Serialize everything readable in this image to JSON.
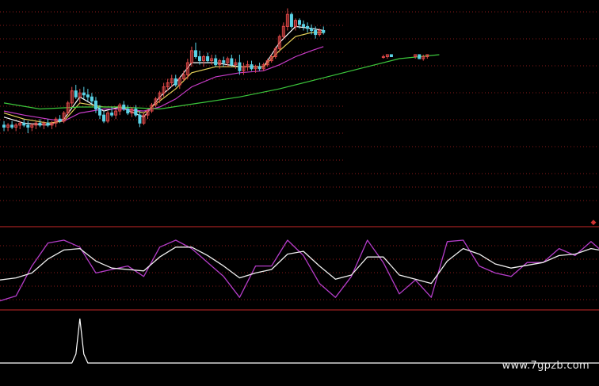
{
  "watermark": "www.7gpzb.com",
  "colors": {
    "background": "#000000",
    "grid": "#8a1a1a",
    "separator": "#c82828",
    "candle_up": "#e04848",
    "candle_down": "#5ad2e6",
    "ma_short": "#ffffff",
    "ma_mid": "#e6d25a",
    "ma_long": "#c83cc8",
    "ma_longest": "#3cc83c",
    "osc_fast": "#b43cc8",
    "osc_slow": "#f0f0f0",
    "signal": "#ffffff",
    "marker": "#d23232"
  },
  "chart_data": [
    {
      "type": "candlestick",
      "panel": "price",
      "x_range": [
        0,
        150
      ],
      "ylim": [
        0,
        100
      ],
      "grid": true,
      "candles": [
        {
          "x": 1,
          "o": 41,
          "h": 43,
          "l": 38,
          "c": 40
        },
        {
          "x": 2,
          "o": 40,
          "h": 42,
          "l": 38,
          "c": 41
        },
        {
          "x": 3,
          "o": 41,
          "h": 43,
          "l": 39,
          "c": 40
        },
        {
          "x": 4,
          "o": 40,
          "h": 42,
          "l": 38,
          "c": 41
        },
        {
          "x": 5,
          "o": 41,
          "h": 43,
          "l": 39,
          "c": 42
        },
        {
          "x": 6,
          "o": 42,
          "h": 44,
          "l": 40,
          "c": 41
        },
        {
          "x": 7,
          "o": 41,
          "h": 43,
          "l": 37,
          "c": 40
        },
        {
          "x": 8,
          "o": 40,
          "h": 42,
          "l": 38,
          "c": 41
        },
        {
          "x": 9,
          "o": 41,
          "h": 43,
          "l": 39,
          "c": 42
        },
        {
          "x": 10,
          "o": 42,
          "h": 44,
          "l": 40,
          "c": 41
        },
        {
          "x": 11,
          "o": 41,
          "h": 43,
          "l": 39,
          "c": 42
        },
        {
          "x": 12,
          "o": 42,
          "h": 44,
          "l": 40,
          "c": 41
        },
        {
          "x": 13,
          "o": 41,
          "h": 43,
          "l": 39,
          "c": 42
        },
        {
          "x": 14,
          "o": 42,
          "h": 45,
          "l": 40,
          "c": 44
        },
        {
          "x": 15,
          "o": 44,
          "h": 46,
          "l": 42,
          "c": 43
        },
        {
          "x": 16,
          "o": 43,
          "h": 48,
          "l": 42,
          "c": 47
        },
        {
          "x": 17,
          "o": 47,
          "h": 53,
          "l": 46,
          "c": 52
        },
        {
          "x": 18,
          "o": 52,
          "h": 60,
          "l": 50,
          "c": 58
        },
        {
          "x": 19,
          "o": 58,
          "h": 61,
          "l": 54,
          "c": 55
        },
        {
          "x": 20,
          "o": 55,
          "h": 59,
          "l": 52,
          "c": 57
        },
        {
          "x": 21,
          "o": 57,
          "h": 60,
          "l": 54,
          "c": 56
        },
        {
          "x": 22,
          "o": 56,
          "h": 59,
          "l": 53,
          "c": 55
        },
        {
          "x": 23,
          "o": 55,
          "h": 57,
          "l": 51,
          "c": 53
        },
        {
          "x": 24,
          "o": 53,
          "h": 55,
          "l": 47,
          "c": 49
        },
        {
          "x": 25,
          "o": 49,
          "h": 51,
          "l": 44,
          "c": 46
        },
        {
          "x": 26,
          "o": 46,
          "h": 48,
          "l": 42,
          "c": 43
        },
        {
          "x": 27,
          "o": 43,
          "h": 48,
          "l": 42,
          "c": 47
        },
        {
          "x": 28,
          "o": 47,
          "h": 50,
          "l": 45,
          "c": 46
        },
        {
          "x": 29,
          "o": 46,
          "h": 49,
          "l": 44,
          "c": 48
        },
        {
          "x": 30,
          "o": 48,
          "h": 52,
          "l": 46,
          "c": 51
        },
        {
          "x": 31,
          "o": 51,
          "h": 53,
          "l": 48,
          "c": 49
        },
        {
          "x": 32,
          "o": 49,
          "h": 51,
          "l": 46,
          "c": 47
        },
        {
          "x": 33,
          "o": 47,
          "h": 50,
          "l": 45,
          "c": 49
        },
        {
          "x": 34,
          "o": 49,
          "h": 51,
          "l": 45,
          "c": 46
        },
        {
          "x": 35,
          "o": 46,
          "h": 48,
          "l": 40,
          "c": 42
        },
        {
          "x": 36,
          "o": 42,
          "h": 47,
          "l": 41,
          "c": 46
        },
        {
          "x": 37,
          "o": 46,
          "h": 49,
          "l": 44,
          "c": 48
        },
        {
          "x": 38,
          "o": 48,
          "h": 52,
          "l": 47,
          "c": 51
        },
        {
          "x": 39,
          "o": 51,
          "h": 55,
          "l": 50,
          "c": 54
        },
        {
          "x": 40,
          "o": 54,
          "h": 58,
          "l": 52,
          "c": 57
        },
        {
          "x": 41,
          "o": 57,
          "h": 62,
          "l": 55,
          "c": 60
        },
        {
          "x": 42,
          "o": 60,
          "h": 64,
          "l": 58,
          "c": 62
        },
        {
          "x": 43,
          "o": 62,
          "h": 66,
          "l": 60,
          "c": 64
        },
        {
          "x": 44,
          "o": 64,
          "h": 66,
          "l": 60,
          "c": 61
        },
        {
          "x": 45,
          "o": 61,
          "h": 65,
          "l": 59,
          "c": 64
        },
        {
          "x": 46,
          "o": 64,
          "h": 68,
          "l": 63,
          "c": 66
        },
        {
          "x": 47,
          "o": 66,
          "h": 74,
          "l": 64,
          "c": 72
        },
        {
          "x": 48,
          "o": 72,
          "h": 80,
          "l": 70,
          "c": 78
        },
        {
          "x": 49,
          "o": 78,
          "h": 82,
          "l": 74,
          "c": 75
        },
        {
          "x": 50,
          "o": 75,
          "h": 78,
          "l": 71,
          "c": 73
        },
        {
          "x": 51,
          "o": 73,
          "h": 76,
          "l": 70,
          "c": 75
        },
        {
          "x": 52,
          "o": 75,
          "h": 77,
          "l": 72,
          "c": 73
        },
        {
          "x": 53,
          "o": 73,
          "h": 76,
          "l": 71,
          "c": 74
        },
        {
          "x": 54,
          "o": 74,
          "h": 76,
          "l": 70,
          "c": 71
        },
        {
          "x": 55,
          "o": 71,
          "h": 74,
          "l": 69,
          "c": 73
        },
        {
          "x": 56,
          "o": 73,
          "h": 75,
          "l": 70,
          "c": 72
        },
        {
          "x": 57,
          "o": 72,
          "h": 75,
          "l": 70,
          "c": 74
        },
        {
          "x": 58,
          "o": 74,
          "h": 76,
          "l": 70,
          "c": 71
        },
        {
          "x": 59,
          "o": 71,
          "h": 74,
          "l": 69,
          "c": 72
        },
        {
          "x": 60,
          "o": 72,
          "h": 76,
          "l": 66,
          "c": 68
        },
        {
          "x": 61,
          "o": 68,
          "h": 72,
          "l": 66,
          "c": 70
        },
        {
          "x": 62,
          "o": 70,
          "h": 73,
          "l": 68,
          "c": 71
        },
        {
          "x": 63,
          "o": 71,
          "h": 73,
          "l": 68,
          "c": 69
        },
        {
          "x": 64,
          "o": 69,
          "h": 71,
          "l": 67,
          "c": 70
        },
        {
          "x": 65,
          "o": 70,
          "h": 72,
          "l": 68,
          "c": 69
        },
        {
          "x": 66,
          "o": 69,
          "h": 72,
          "l": 68,
          "c": 71
        },
        {
          "x": 67,
          "o": 71,
          "h": 74,
          "l": 70,
          "c": 73
        },
        {
          "x": 68,
          "o": 73,
          "h": 76,
          "l": 72,
          "c": 75
        },
        {
          "x": 69,
          "o": 75,
          "h": 80,
          "l": 74,
          "c": 79
        },
        {
          "x": 70,
          "o": 79,
          "h": 86,
          "l": 78,
          "c": 85
        },
        {
          "x": 71,
          "o": 85,
          "h": 92,
          "l": 84,
          "c": 90
        },
        {
          "x": 72,
          "o": 90,
          "h": 99,
          "l": 88,
          "c": 96
        },
        {
          "x": 73,
          "o": 96,
          "h": 97,
          "l": 89,
          "c": 90
        },
        {
          "x": 74,
          "o": 90,
          "h": 94,
          "l": 88,
          "c": 93
        },
        {
          "x": 75,
          "o": 93,
          "h": 94,
          "l": 89,
          "c": 91
        },
        {
          "x": 76,
          "o": 91,
          "h": 93,
          "l": 88,
          "c": 90
        },
        {
          "x": 77,
          "o": 90,
          "h": 92,
          "l": 87,
          "c": 89
        },
        {
          "x": 78,
          "o": 89,
          "h": 91,
          "l": 86,
          "c": 88
        },
        {
          "x": 79,
          "o": 88,
          "h": 90,
          "l": 84,
          "c": 86
        },
        {
          "x": 80,
          "o": 86,
          "h": 89,
          "l": 85,
          "c": 88
        },
        {
          "x": 81,
          "o": 88,
          "h": 90,
          "l": 86,
          "c": 87
        },
        {
          "x": 96,
          "o": 75,
          "h": 76,
          "l": 74,
          "c": 75
        },
        {
          "x": 97,
          "o": 75,
          "h": 76,
          "l": 74,
          "c": 76
        },
        {
          "x": 98,
          "o": 76,
          "h": 76,
          "l": 75,
          "c": 75
        },
        {
          "x": 104,
          "o": 75,
          "h": 76,
          "l": 74,
          "c": 76
        },
        {
          "x": 105,
          "o": 76,
          "h": 76,
          "l": 74,
          "c": 74
        },
        {
          "x": 106,
          "o": 74,
          "h": 76,
          "l": 73,
          "c": 75
        },
        {
          "x": 107,
          "o": 75,
          "h": 76,
          "l": 74,
          "c": 76
        }
      ],
      "series": [
        {
          "role": "ma_short",
          "x": [
            1,
            6,
            12,
            16,
            20,
            26,
            30,
            36,
            40,
            44,
            48,
            54,
            60,
            66,
            70,
            74,
            78,
            81
          ],
          "y": [
            45,
            42,
            41,
            44,
            55,
            48,
            50,
            45,
            55,
            62,
            72,
            72,
            70,
            70,
            82,
            90,
            89,
            88
          ]
        },
        {
          "role": "ma_mid",
          "x": [
            1,
            6,
            12,
            16,
            20,
            26,
            30,
            36,
            40,
            44,
            48,
            54,
            60,
            66,
            70,
            74,
            78,
            81
          ],
          "y": [
            47,
            44,
            42,
            43,
            52,
            50,
            50,
            47,
            53,
            59,
            67,
            70,
            70,
            70,
            78,
            85,
            87,
            87
          ]
        },
        {
          "role": "ma_long",
          "x": [
            1,
            6,
            12,
            16,
            20,
            26,
            30,
            36,
            40,
            44,
            48,
            54,
            60,
            66,
            70,
            74,
            78,
            81
          ],
          "y": [
            48,
            46,
            44,
            43,
            47,
            49,
            49,
            48,
            50,
            54,
            60,
            65,
            67,
            68,
            71,
            75,
            78,
            80
          ]
        },
        {
          "role": "ma_longest",
          "x": [
            1,
            10,
            20,
            30,
            40,
            50,
            60,
            70,
            80,
            90,
            100,
            110
          ],
          "y": [
            52,
            49,
            50,
            50,
            49,
            52,
            55,
            59,
            64,
            69,
            74,
            76
          ]
        }
      ]
    },
    {
      "type": "line",
      "panel": "oscillator",
      "x_range": [
        0,
        150
      ],
      "ylim": [
        0,
        100
      ],
      "grid": true,
      "series": [
        {
          "role": "osc_fast",
          "x": [
            0,
            4,
            8,
            12,
            16,
            20,
            24,
            28,
            32,
            36,
            40,
            44,
            48,
            52,
            56,
            60,
            64,
            68,
            72,
            76,
            80,
            84,
            88,
            92,
            96,
            100,
            104,
            108,
            112,
            116,
            120,
            124,
            128,
            132,
            136,
            140,
            144,
            148,
            150
          ],
          "y": [
            5,
            12,
            55,
            88,
            92,
            82,
            45,
            50,
            55,
            40,
            82,
            92,
            80,
            60,
            40,
            10,
            55,
            55,
            92,
            70,
            30,
            10,
            40,
            92,
            60,
            15,
            35,
            10,
            90,
            92,
            55,
            45,
            40,
            60,
            60,
            80,
            70,
            90,
            80
          ]
        },
        {
          "role": "osc_slow",
          "x": [
            0,
            4,
            8,
            12,
            16,
            20,
            24,
            28,
            32,
            36,
            40,
            44,
            48,
            52,
            56,
            60,
            64,
            68,
            72,
            76,
            80,
            84,
            88,
            92,
            96,
            100,
            104,
            108,
            112,
            116,
            120,
            124,
            128,
            132,
            136,
            140,
            144,
            148,
            150
          ],
          "y": [
            35,
            38,
            45,
            65,
            78,
            80,
            62,
            52,
            50,
            48,
            68,
            82,
            82,
            70,
            55,
            38,
            45,
            50,
            72,
            76,
            55,
            36,
            42,
            68,
            68,
            42,
            36,
            30,
            62,
            80,
            72,
            58,
            52,
            56,
            60,
            70,
            72,
            80,
            78
          ]
        }
      ]
    },
    {
      "type": "line",
      "panel": "signal",
      "x_range": [
        0,
        150
      ],
      "ylim": [
        0,
        100
      ],
      "series": [
        {
          "role": "signal",
          "x": [
            0,
            18,
            19,
            20,
            21,
            22,
            150
          ],
          "y": [
            0,
            0,
            20,
            100,
            20,
            0,
            0
          ]
        }
      ]
    }
  ]
}
